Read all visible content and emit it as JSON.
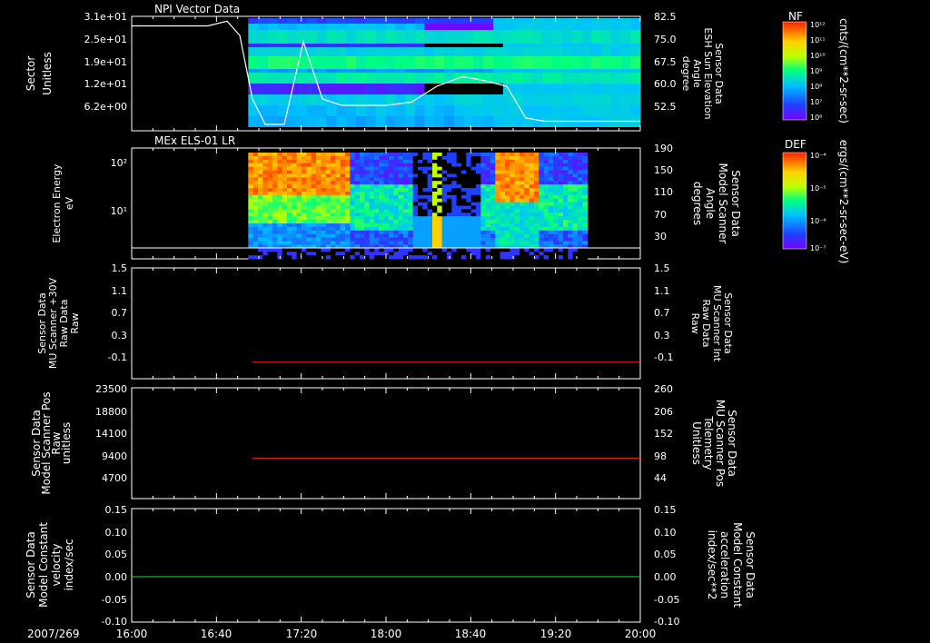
{
  "date_label": "2007/269",
  "time_ticks": [
    "16:00",
    "16:40",
    "17:20",
    "18:00",
    "18:40",
    "19:20",
    "20:00"
  ],
  "panels": [
    {
      "title": "NPI Vector Data",
      "left_ylabel": [
        "Sector",
        "Unitless"
      ],
      "left_ticks": [
        "3.1e+01",
        "2.5e+01",
        "1.9e+01",
        "1.2e+01",
        "6.2e+00"
      ],
      "right_ylabel": [
        "Sensor Data",
        "ESH Sun Elevation",
        "Angle",
        "degree"
      ],
      "right_ticks": [
        "82.5",
        "75.0",
        "67.5",
        "60.0",
        "52.5"
      ]
    },
    {
      "title": "MEx ELS-01 LR",
      "left_ylabel": [
        "Electron Energy",
        "eV"
      ],
      "left_ticks": [
        "10²",
        "10¹"
      ],
      "right_ylabel": [
        "Sensor Data",
        "Model Scanner",
        "Angle",
        "degrees"
      ],
      "right_ticks": [
        "190",
        "150",
        "110",
        "70",
        "30"
      ]
    },
    {
      "left_ylabel": [
        "Sensor Data",
        "MU Scanner +30V",
        "Raw Data",
        "Raw"
      ],
      "left_ticks": [
        "1.5",
        "1.1",
        "0.7",
        "0.3",
        "-0.1"
      ],
      "right_ylabel": [
        "Sensor Data",
        "MU Scanner Int",
        "Raw Data",
        "Raw"
      ],
      "right_ticks": [
        "1.5",
        "1.1",
        "0.7",
        "0.3",
        "-0.1"
      ]
    },
    {
      "left_ylabel": [
        "Sensor Data",
        "Model Scanner Pos",
        "Raw",
        "unitless"
      ],
      "left_ticks": [
        "23500",
        "18800",
        "14100",
        "9400",
        "4700"
      ],
      "right_ylabel": [
        "Sensor Data",
        "MU Scanner Pos",
        "Telemetry",
        "Unitless"
      ],
      "right_ticks": [
        "260",
        "206",
        "152",
        "98",
        "44"
      ]
    },
    {
      "left_ylabel": [
        "Sensor Data",
        "Model Constant",
        "velocity",
        "index/sec"
      ],
      "left_ticks": [
        "0.15",
        "0.10",
        "0.05",
        "0.00",
        "-0.05",
        "-0.10"
      ],
      "right_ylabel": [
        "Sensor Data",
        "Model Constant",
        "acceleration",
        "index/sec**2"
      ],
      "right_ticks": [
        "0.15",
        "0.10",
        "0.05",
        "0.00",
        "-0.05",
        "-0.10"
      ]
    }
  ],
  "colorbars": [
    {
      "label": "NF",
      "units": "cnts/(cm**2-sr-sec)",
      "ticks": [
        "10¹²",
        "10¹¹",
        "10¹⁰",
        "10⁹",
        "10⁸",
        "10⁷",
        "10⁶"
      ]
    },
    {
      "label": "DEF",
      "units": "ergs/(cm**2-sr-sec-eV)",
      "ticks": [
        "10⁻⁴",
        "10⁻⁵",
        "10⁻⁶",
        "10⁻⁷"
      ]
    }
  ],
  "colors": {
    "red_trace": "#ff2020",
    "green_trace": "#20e020",
    "axis": "#ffffff",
    "right_label_red": "#ff2020",
    "right_label_green": "#20e020"
  },
  "chart_data": [
    {
      "type": "heatmap",
      "title": "NPI Vector Data",
      "x_range": [
        "16:00",
        "20:00"
      ],
      "ylim_left": [
        0,
        31
      ],
      "ylim_right": [
        48,
        84
      ],
      "data_coverage": [
        "16:55",
        "20:00"
      ],
      "line_series": {
        "name": "Sensor Data ESH Sun Elevation Angle",
        "x_hours": [
          16.0,
          16.6,
          16.75,
          16.85,
          16.95,
          17.05,
          17.2,
          17.35,
          17.5,
          17.65,
          17.8,
          18.0,
          18.2,
          18.4,
          18.6,
          18.75,
          18.95,
          19.1,
          19.25,
          20.0
        ],
        "y": [
          81,
          81,
          82.5,
          78,
          58,
          50,
          50,
          76,
          58,
          56,
          56,
          56,
          57,
          62,
          65,
          64,
          62,
          52,
          51,
          51
        ]
      }
    },
    {
      "type": "heatmap",
      "title": "MEx ELS-01 LR",
      "x_range": [
        "16:00",
        "20:00"
      ],
      "yscale": "log",
      "ylim": [
        1,
        200
      ],
      "ylim_right": [
        0,
        190
      ],
      "data_coverage": [
        "16:55",
        "19:35"
      ]
    },
    {
      "type": "line",
      "x_range": [
        "16:00",
        "20:00"
      ],
      "ylim": [
        -0.3,
        1.5
      ],
      "series": [
        {
          "x_hours": [
            16.95,
            20.0
          ],
          "values": [
            -0.03,
            -0.03
          ]
        }
      ]
    },
    {
      "type": "line",
      "x_range": [
        "16:00",
        "20:00"
      ],
      "ylim": [
        0,
        23500
      ],
      "series": [
        {
          "x_hours": [
            16.95,
            20.0
          ],
          "values": [
            8600,
            8600
          ]
        }
      ]
    },
    {
      "type": "line",
      "x_range": [
        "16:00",
        "20:00"
      ],
      "ylim": [
        -0.1,
        0.15
      ],
      "series": [
        {
          "x_hours": [
            16.0,
            20.0
          ],
          "values": [
            0.0,
            0.0
          ]
        }
      ]
    }
  ]
}
